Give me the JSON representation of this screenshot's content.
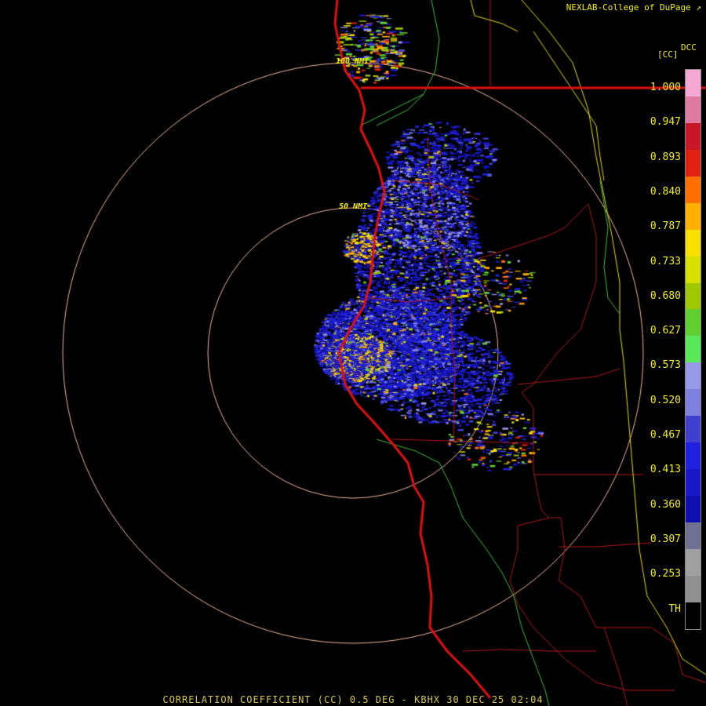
{
  "header": {
    "credit": "NEXLAB-College of DuPage"
  },
  "legend": {
    "title": "DCC",
    "unit": "[CC]",
    "ticks": [
      "1.000",
      "0.947",
      "0.893",
      "0.840",
      "0.787",
      "0.733",
      "0.680",
      "0.627",
      "0.573",
      "0.520",
      "0.467",
      "0.413",
      "0.360",
      "0.307",
      "0.253",
      "TH"
    ],
    "colors": [
      "#f5a8d4",
      "#e07aa0",
      "#c81828",
      "#e02010",
      "#ff7000",
      "#ffb000",
      "#f8e000",
      "#d8e000",
      "#a0c800",
      "#60d030",
      "#58e858",
      "#9898e8",
      "#8080e0",
      "#4040d0",
      "#2020e0",
      "#1818c8",
      "#1010b0",
      "#707090",
      "#a0a0a0",
      "#909090",
      "#000000"
    ]
  },
  "rings": {
    "labels": [
      "50 NMI",
      "100 NMI"
    ]
  },
  "footer": {
    "caption": "CORRELATION COEFFICIENT (CC) 0.5 DEG - KBHX 30 DEC 25 02:04"
  }
}
